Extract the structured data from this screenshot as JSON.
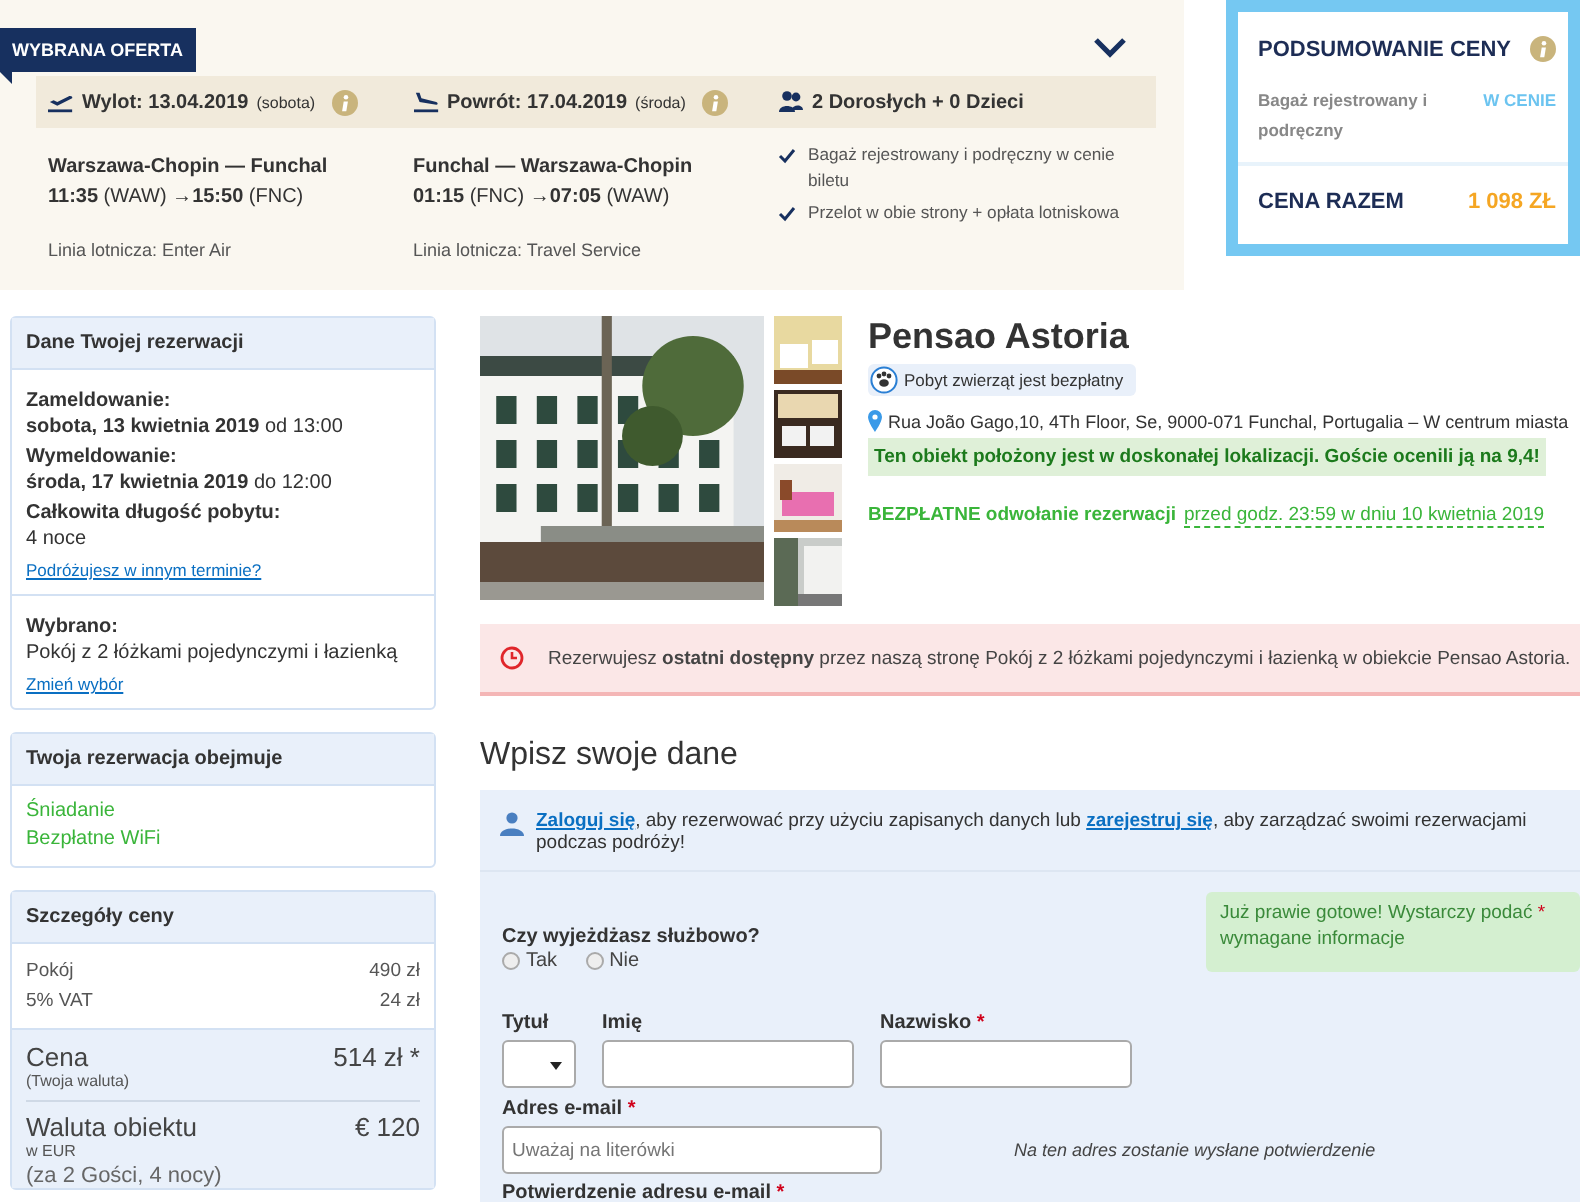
{
  "offer": {
    "badge": "WYBRANA OFERTA",
    "legs": [
      {
        "kind": "departure",
        "title": "Wylot: 13.04.2019",
        "day": "(sobota)",
        "route": "Warszawa-Chopin — Funchal",
        "times": "**11:35** (WAW) →**15:50** (FNC)",
        "airline": "Linia lotnicza: Enter Air"
      },
      {
        "kind": "return",
        "title": "Powrót: 17.04.2019",
        "day": "(środa)",
        "route": "Funchal — Warszawa-Chopin",
        "times": "**01:15** (FNC) →**07:05** (WAW)",
        "airline": "Linia lotnicza: Travel Service"
      }
    ],
    "passengers": "2 Dorosłych + 0 Dzieci",
    "features": [
      "Bagaż rejestrowany i podręczny w cenie biletu",
      "Przelot w obie strony + opłata lotniskowa"
    ]
  },
  "summary": {
    "title": "PODSUMOWANIE CENY",
    "items": [
      {
        "label": "Bagaż rejestrowany i podręczny",
        "value": "W CENIE"
      }
    ],
    "total_label": "CENA RAZEM",
    "total_value": "1 098 ZŁ"
  },
  "booking": {
    "title": "Dane Twojej rezerwacji",
    "entries": [
      {
        "label": "Zameldowanie:",
        "value": "**sobota, 13 kwietnia 2019** od 13:00"
      },
      {
        "label": "Wymeldowanie:",
        "value": "**środa, 17 kwietnia 2019** do 12:00"
      },
      {
        "label": "Całkowita długość pobytu:",
        "value": "4 noce"
      }
    ],
    "date_link": "Podróżujesz w innym terminie?",
    "chosen_label": "Wybrano:",
    "chosen_value": "Pokój z 2 łóżkami pojedynczymi i łazienką",
    "change_link": "Zmień wybór"
  },
  "includes": {
    "title": "Twoja rezerwacja obejmuje",
    "items": [
      "Śniadanie",
      "Bezpłatne WiFi"
    ]
  },
  "price": {
    "title": "Szczegóły ceny",
    "rows": [
      {
        "label": "Pokój",
        "value": "490 zł"
      },
      {
        "label": "5% VAT",
        "value": "24 zł"
      }
    ],
    "total": {
      "label": "Cena",
      "sub": "(Twoja waluta)",
      "value": "514 zł *"
    },
    "property": {
      "label": "Waluta obiektu",
      "sub": "w EUR",
      "value": "€ 120"
    },
    "note": "(za 2 Gości, 4 nocy)"
  },
  "hotel": {
    "name": "Pensao Astoria",
    "pets": "Pobyt zwierząt jest bezpłatny",
    "address": "Rua João Gago,10, 4Th Floor, Se, 9000-071 Funchal, Portugalia – W centrum miasta",
    "location_note": "Ten obiekt położony jest w doskonałej lokalizacji. Goście ocenili ją na 9,4!",
    "cancel_bold": "BEZPŁATNE odwołanie rezerwacji",
    "cancel_terms": "przed godz. 23:59 w dniu 10 kwietnia 2019"
  },
  "alert": "Rezerwujesz **ostatni dostępny** przez naszą stronę Pokój z 2 łóżkami pojedynczymi i łazienką w obiekcie Pensao Astoria.",
  "form": {
    "heading": "Wpisz swoje dane",
    "login": [
      {
        "kind": "link",
        "text": "Zaloguj się"
      },
      {
        "kind": "text",
        "text": ", aby rezerwować przy użyciu zapisanych danych lub "
      },
      {
        "kind": "link",
        "text": "zarejestruj się"
      },
      {
        "kind": "text",
        "text": ", aby zarządzać swoimi rezerwacjami podczas podróży!"
      }
    ],
    "business": {
      "question": "Czy wyjeżdżasz służbowo?",
      "options": [
        {
          "label": "Tak",
          "selected": false
        },
        {
          "label": "Nie",
          "selected": false
        }
      ]
    },
    "hint": {
      "before": "Już prawie gotowe! Wystarczy podać",
      "mark": "*",
      "after": "wymagane informacje"
    },
    "fields": [
      {
        "kind": "select",
        "label": "Tytuł"
      },
      {
        "kind": "input",
        "label": "Imię"
      },
      {
        "kind": "input",
        "label": "Nazwisko",
        "mark": "*"
      }
    ],
    "email": {
      "label": "Adres e-mail",
      "mark": "*",
      "placeholder": "Uważaj na literówki",
      "note": "Na ten adres zostanie wysłane potwierdzenie"
    },
    "confirm": {
      "label": "Potwierdzenie adresu e-mail",
      "mark": "*"
    }
  }
}
